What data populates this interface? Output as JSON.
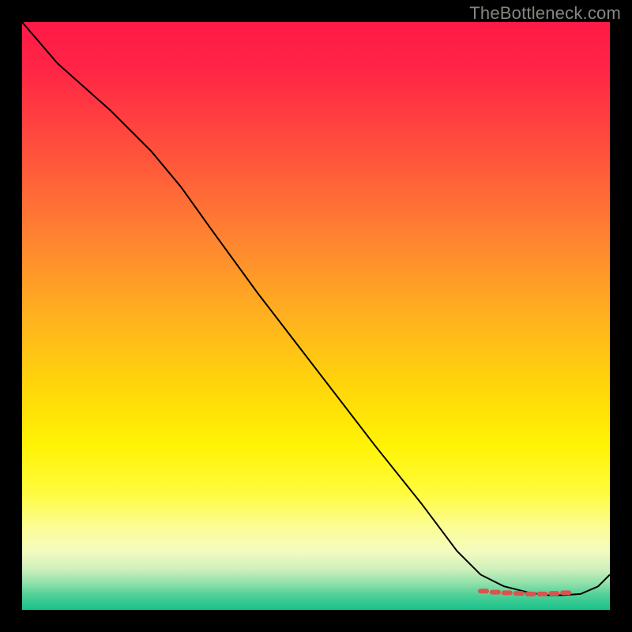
{
  "attribution": "TheBottleneck.com",
  "chart_data": {
    "type": "line",
    "title": "",
    "xlabel": "",
    "ylabel": "",
    "xlim": [
      0,
      100
    ],
    "ylim": [
      0,
      100
    ],
    "legend": false,
    "grid": false,
    "background_gradient": {
      "stops": [
        {
          "offset": 0.0,
          "color": "#ff1a47"
        },
        {
          "offset": 0.08,
          "color": "#ff2545"
        },
        {
          "offset": 0.2,
          "color": "#ff4a3e"
        },
        {
          "offset": 0.35,
          "color": "#ff7d33"
        },
        {
          "offset": 0.5,
          "color": "#ffb11f"
        },
        {
          "offset": 0.62,
          "color": "#ffd60a"
        },
        {
          "offset": 0.72,
          "color": "#fff304"
        },
        {
          "offset": 0.8,
          "color": "#fffb3d"
        },
        {
          "offset": 0.86,
          "color": "#fcfd97"
        },
        {
          "offset": 0.9,
          "color": "#f4fbbf"
        },
        {
          "offset": 0.93,
          "color": "#d0f0bc"
        },
        {
          "offset": 0.955,
          "color": "#8fe0a9"
        },
        {
          "offset": 0.975,
          "color": "#4fd098"
        },
        {
          "offset": 1.0,
          "color": "#17c28b"
        }
      ]
    },
    "series": [
      {
        "name": "bottleneck-curve",
        "color": "#000000",
        "x": [
          0,
          6,
          15,
          22,
          27,
          32,
          40,
          50,
          60,
          68,
          74,
          78,
          82,
          86,
          89,
          92,
          95,
          98,
          100
        ],
        "y": [
          100,
          93,
          85,
          78,
          72,
          65,
          54,
          41,
          28,
          18,
          10,
          6,
          4,
          3,
          2.5,
          2.5,
          2.7,
          4,
          6
        ]
      }
    ],
    "markers": {
      "name": "highlight-range",
      "color": "#d9544f",
      "shape": "rounded",
      "x": [
        78.5,
        80.5,
        82.5,
        84.5,
        86.5,
        88.5,
        90.5,
        92.5
      ],
      "y": [
        3.2,
        3.0,
        2.9,
        2.8,
        2.7,
        2.7,
        2.8,
        2.9
      ]
    }
  }
}
